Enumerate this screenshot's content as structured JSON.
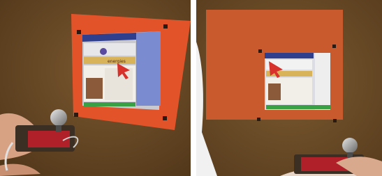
{
  "photos": [
    {
      "id": "left",
      "wall_color": "#6b4b25",
      "projection_color": "#e8532a",
      "screen_text": "energies"
    },
    {
      "id": "right",
      "wall_color": "#6d4d27",
      "projection_color": "#c65a2e",
      "screen_text": ""
    }
  ]
}
